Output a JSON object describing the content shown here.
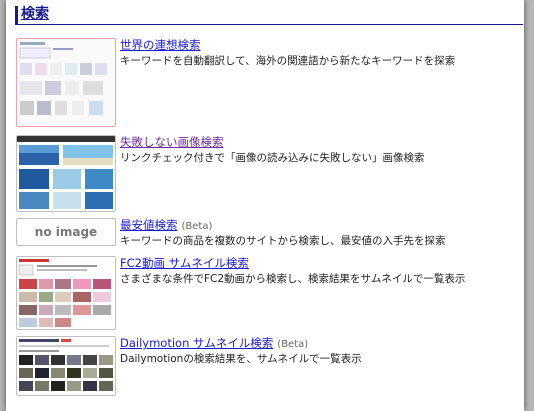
{
  "header": {
    "title": "検索"
  },
  "items": [
    {
      "title": "世界の連想検索",
      "beta": "",
      "description": "キーワードを自動翻訳して、海外の関連語から新たなキーワードを探索",
      "thumb": "world-association-search-screenshot"
    },
    {
      "title": "失敗しない画像検索",
      "beta": "",
      "description": "リンクチェック付きで「画像の読み込みに失敗しない」画像検索",
      "thumb": "image-search-screenshot"
    },
    {
      "title": "最安値検索",
      "beta": "(Beta)",
      "description": "キーワードの商品を複数のサイトから検索し、最安値の入手先を探索",
      "thumb_text": "no image"
    },
    {
      "title": "FC2動画 サムネイル検索",
      "beta": "",
      "description": "さまざまな条件でFC2動画から検索し、検索結果をサムネイルで一覧表示",
      "thumb": "fc2-video-search-screenshot"
    },
    {
      "title": "Dailymotion サムネイル検索",
      "beta": "(Beta)",
      "description": "Dailymotionの検索結果を、サムネイルで一覧表示",
      "thumb": "dailymotion-search-screenshot"
    }
  ],
  "colors": {
    "header": "#1a1a8c",
    "link": "#1a1ad0",
    "visited": "#6b2a99",
    "background": "#b8b8b8"
  }
}
